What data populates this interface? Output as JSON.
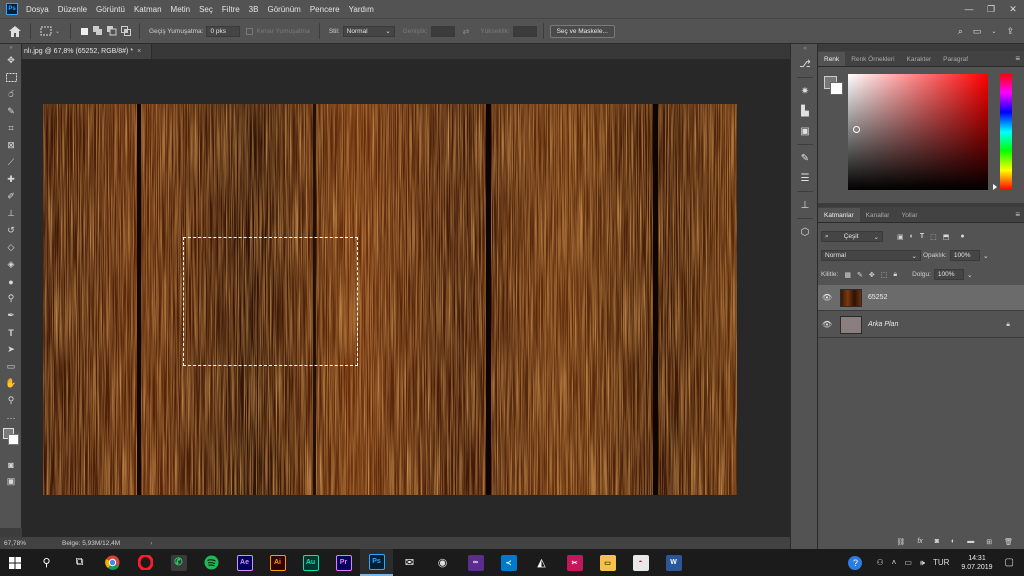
{
  "menubar": {
    "logo": "Ps",
    "items": [
      "Dosya",
      "Düzenle",
      "Görüntü",
      "Katman",
      "Metin",
      "Seç",
      "Filtre",
      "3B",
      "Görünüm",
      "Pencere",
      "Yardım"
    ],
    "controls": [
      "—",
      "❐",
      "✕"
    ]
  },
  "options": {
    "feather_label": "Geçiş Yumuşatma:",
    "feather_value": "0 pks",
    "antialias_label": "Kenar Yumuşatma",
    "style_label": "Stil:",
    "style_value": "Normal",
    "width_label": "Genişlik:",
    "height_label": "Yükseklik:",
    "select_mask_button": "Seç ve Maskele..."
  },
  "document": {
    "tab_title": "nlı.jpg @ 67,8% (65252, RGB/8#) *",
    "tab_close": "×",
    "zoom": "67,78%",
    "doc_info": "Belge: 5,93M/12,4M",
    "arrow": "›"
  },
  "color_panel": {
    "tabs": [
      "Renk",
      "Renk Örnekleri",
      "Karakter",
      "Paragraf"
    ],
    "active_tab": 0,
    "fg_color": "#ffffff",
    "bg_color": "#ffffff"
  },
  "layers_panel": {
    "tabs": [
      "Katmanlar",
      "Kanallar",
      "Yollar"
    ],
    "filter_value": "Çeşit",
    "blend_mode": "Normal",
    "opacity_label": "Opaklık:",
    "opacity_value": "100%",
    "lock_label": "Kilitle:",
    "fill_label": "Dolgu:",
    "fill_value": "100%",
    "layers": [
      {
        "name": "65252",
        "selected": true,
        "italic": false,
        "locked": false
      },
      {
        "name": "Arka Plan",
        "selected": false,
        "italic": true,
        "locked": true
      }
    ]
  },
  "taskbar": {
    "language": "TUR",
    "time": "14:31",
    "date": "9.07.2019",
    "apps": [
      {
        "name": "Ae",
        "bg": "#00005b",
        "fg": "#d291ff"
      },
      {
        "name": "Ai",
        "bg": "#330000",
        "fg": "#ff9a00"
      },
      {
        "name": "Au",
        "bg": "#00382e",
        "fg": "#00e4bb"
      },
      {
        "name": "Pr",
        "bg": "#00005b",
        "fg": "#ea77ff"
      },
      {
        "name": "Ps",
        "bg": "#001e36",
        "fg": "#31a8ff"
      }
    ]
  },
  "colors": {
    "wood_dark": "#1a0a03",
    "wood_mid": "#6b300c",
    "wood_light": "#b0581a"
  }
}
